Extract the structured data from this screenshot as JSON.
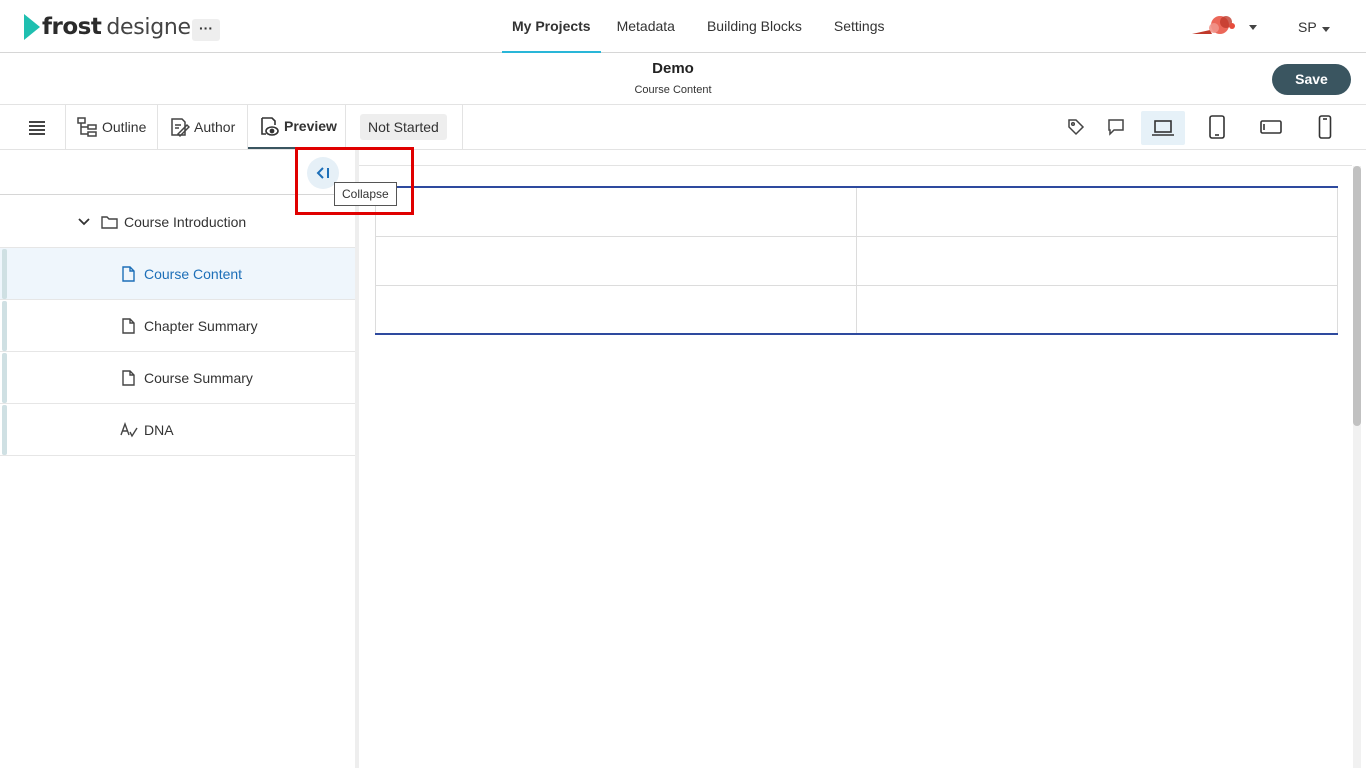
{
  "app": {
    "logo_bold": "frost",
    "logo_text": "designer",
    "more_label": "···"
  },
  "nav": {
    "items": [
      {
        "label": "My Projects",
        "active": true
      },
      {
        "label": "Metadata"
      },
      {
        "label": "Building Blocks"
      },
      {
        "label": "Settings"
      }
    ]
  },
  "user": {
    "initials": "SP"
  },
  "document": {
    "title": "Demo",
    "subtitle": "Course Content",
    "save_label": "Save"
  },
  "toolbar": {
    "tabs": [
      {
        "label": "Outline",
        "icon": "outline-icon"
      },
      {
        "label": "Author",
        "icon": "author-icon"
      },
      {
        "label": "Preview",
        "icon": "preview-icon",
        "active": true
      }
    ],
    "status": "Not Started",
    "right_icons": [
      "tag-icon",
      "comment-icon",
      "laptop-icon",
      "tablet-icon",
      "tablet-landscape-icon",
      "phone-icon"
    ],
    "active_device": "laptop-icon"
  },
  "sidebar": {
    "collapse_tooltip": "Collapse",
    "tree": [
      {
        "label": "Course Introduction",
        "type": "folder",
        "expanded": true
      },
      {
        "label": "Course Content",
        "type": "page",
        "selected": true
      },
      {
        "label": "Chapter Summary",
        "type": "page"
      },
      {
        "label": "Course Summary",
        "type": "page"
      },
      {
        "label": "DNA",
        "type": "dna"
      }
    ]
  },
  "colors": {
    "accent": "#29b6d8",
    "save": "#3a5560",
    "selected_text": "#1d6fb8",
    "table_border": "#2e4a9e",
    "highlight": "#e00000"
  }
}
